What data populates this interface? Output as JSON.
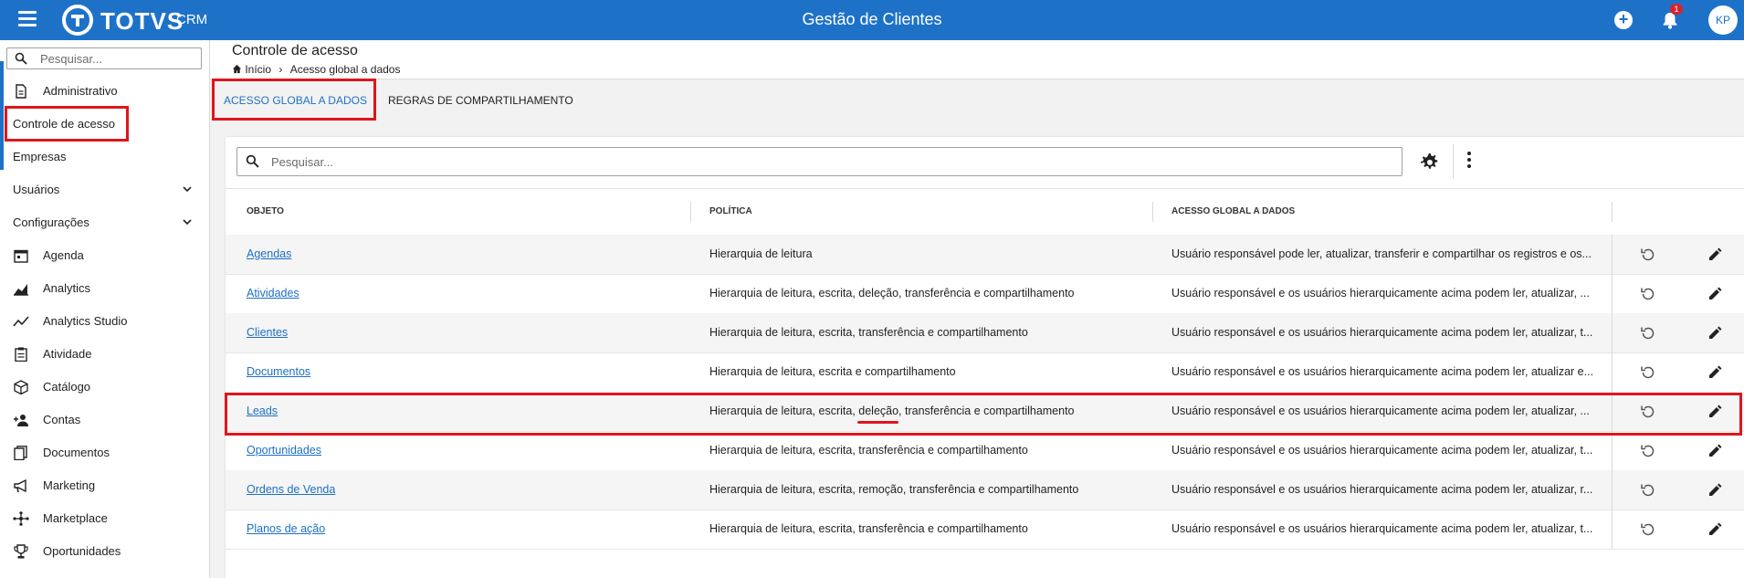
{
  "header": {
    "logo_text": "TOTVS",
    "logo_sub": "CRM",
    "title": "Gestão de Clientes",
    "notifications_count": "1",
    "avatar_initials": "KP",
    "icons": [
      "menu-icon",
      "add-circle-icon",
      "bell-icon"
    ]
  },
  "sidebar": {
    "search_placeholder": "Pesquisar...",
    "items": [
      {
        "label": "Administrativo",
        "icon": "document-icon"
      },
      {
        "label": "Controle de acesso"
      },
      {
        "label": "Empresas"
      },
      {
        "label": "Usuários",
        "expandable": true
      },
      {
        "label": "Configurações",
        "expandable": true
      },
      {
        "label": "Agenda",
        "icon": "calendar-icon"
      },
      {
        "label": "Analytics",
        "icon": "area-chart-icon"
      },
      {
        "label": "Analytics Studio",
        "icon": "line-chart-icon"
      },
      {
        "label": "Atividade",
        "icon": "clipboard-icon"
      },
      {
        "label": "Catálogo",
        "icon": "box-icon"
      },
      {
        "label": "Contas",
        "icon": "add-user-icon"
      },
      {
        "label": "Documentos",
        "icon": "documents-icon"
      },
      {
        "label": "Marketing",
        "icon": "megaphone-icon"
      },
      {
        "label": "Marketplace",
        "icon": "network-icon"
      },
      {
        "label": "Oportunidades",
        "icon": "trophy-icon"
      }
    ]
  },
  "page": {
    "title": "Controle de acesso",
    "breadcrumb": {
      "home": "Início",
      "current": "Acesso global a dados"
    }
  },
  "tabs": [
    {
      "label": "ACESSO GLOBAL A DADOS",
      "active": true
    },
    {
      "label": "REGRAS DE COMPARTILHAMENTO",
      "active": false
    }
  ],
  "table": {
    "search_placeholder": "Pesquisar...",
    "columns": [
      "OBJETO",
      "POLÍTICA",
      "ACESSO GLOBAL A DADOS"
    ],
    "rows": [
      {
        "objeto": "Agendas",
        "politica": "Hierarquia de leitura",
        "acesso": "Usuário responsável pode ler, atualizar, transferir e compartilhar os registros e os..."
      },
      {
        "objeto": "Atividades",
        "politica": "Hierarquia de leitura, escrita, deleção, transferência e compartilhamento",
        "acesso": "Usuário responsável e os usuários hierarquicamente acima podem ler, atualizar, ..."
      },
      {
        "objeto": "Clientes",
        "politica": "Hierarquia de leitura, escrita, transferência e compartilhamento",
        "acesso": "Usuário responsável e os usuários hierarquicamente acima podem ler, atualizar, t..."
      },
      {
        "objeto": "Documentos",
        "politica": "Hierarquia de leitura, escrita e compartilhamento",
        "acesso": "Usuário responsável e os usuários hierarquicamente acima podem ler, atualizar e..."
      },
      {
        "objeto": "Leads",
        "politica": "Hierarquia de leitura, escrita, deleção, transferência e compartilhamento",
        "acesso": "Usuário responsável e os usuários hierarquicamente acima podem ler, atualizar, ..."
      },
      {
        "objeto": "Oportunidades",
        "politica": "Hierarquia de leitura, escrita, transferência e compartilhamento",
        "acesso": "Usuário responsável e os usuários hierarquicamente acima podem ler, atualizar, t..."
      },
      {
        "objeto": "Ordens de Venda",
        "politica": "Hierarquia de leitura, escrita, remoção, transferência e compartilhamento",
        "acesso": "Usuário responsável e os usuários hierarquicamente acima podem ler, atualizar, r..."
      },
      {
        "objeto": "Planos de ação",
        "politica": "Hierarquia de leitura, escrita, transferência e compartilhamento",
        "acesso": "Usuário responsável e os usuários hierarquicamente acima podem ler, atualizar, t..."
      }
    ]
  },
  "colors": {
    "primary": "#1d72c8",
    "highlight": "#e0151b",
    "link": "#1d6fc4"
  }
}
